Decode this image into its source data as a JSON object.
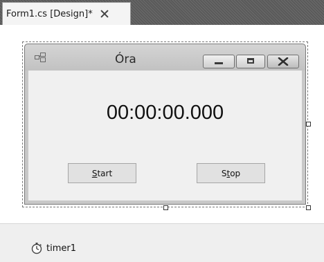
{
  "document_tab": {
    "label": "Form1.cs [Design]*"
  },
  "form": {
    "title": "Óra",
    "clock_text": "00:00:00.000",
    "buttons": {
      "start": {
        "mnemonic": "S",
        "rest": "tart"
      },
      "stop": {
        "before": "S",
        "mnemonic": "t",
        "rest": "op"
      }
    }
  },
  "component_tray": {
    "items": [
      {
        "label": "timer1",
        "icon": "stopwatch-icon"
      }
    ]
  }
}
